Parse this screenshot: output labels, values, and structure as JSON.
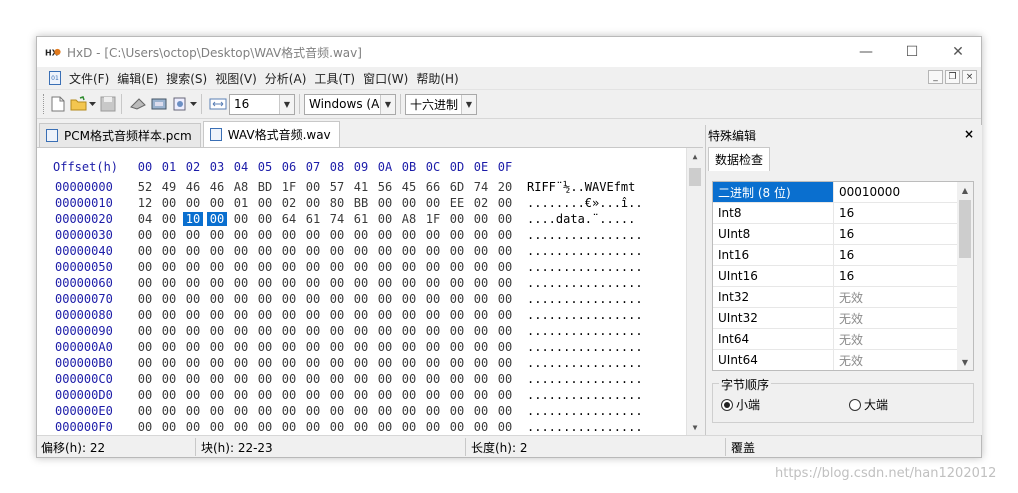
{
  "window": {
    "title": "HxD - [C:\\Users\\octop\\Desktop\\WAV格式音频.wav]",
    "minimize": "—",
    "maximize": "☐",
    "close": "✕"
  },
  "menu": {
    "items": [
      "文件(F)",
      "编辑(E)",
      "搜索(S)",
      "视图(V)",
      "分析(A)",
      "工具(T)",
      "窗口(W)",
      "帮助(H)"
    ],
    "mdi_min": "_",
    "mdi_restore": "❐",
    "mdi_close": "×"
  },
  "toolbar": {
    "bytes_per_row": "16",
    "charset": "Windows (AN",
    "display_mode": "十六进制"
  },
  "tabs": [
    {
      "label": "PCM格式音频样本.pcm",
      "active": false
    },
    {
      "label": "WAV格式音频.wav",
      "active": true
    }
  ],
  "hex": {
    "offset_header": "Offset(h)",
    "columns": [
      "00",
      "01",
      "02",
      "03",
      "04",
      "05",
      "06",
      "07",
      "08",
      "09",
      "0A",
      "0B",
      "0C",
      "0D",
      "0E",
      "0F"
    ],
    "rows": [
      {
        "offset": "00000000",
        "bytes": [
          "52",
          "49",
          "46",
          "46",
          "A8",
          "BD",
          "1F",
          "00",
          "57",
          "41",
          "56",
          "45",
          "66",
          "6D",
          "74",
          "20"
        ],
        "text": "RIFF¨½..WAVEfmt "
      },
      {
        "offset": "00000010",
        "bytes": [
          "12",
          "00",
          "00",
          "00",
          "01",
          "00",
          "02",
          "00",
          "80",
          "BB",
          "00",
          "00",
          "00",
          "EE",
          "02",
          "00"
        ],
        "text": "........€»...î.."
      },
      {
        "offset": "00000020",
        "bytes": [
          "04",
          "00",
          "10",
          "00",
          "00",
          "00",
          "64",
          "61",
          "74",
          "61",
          "00",
          "A8",
          "1F",
          "00",
          "00",
          "00"
        ],
        "text": "....data.¨....."
      },
      {
        "offset": "00000030",
        "bytes": [
          "00",
          "00",
          "00",
          "00",
          "00",
          "00",
          "00",
          "00",
          "00",
          "00",
          "00",
          "00",
          "00",
          "00",
          "00",
          "00"
        ],
        "text": "................"
      },
      {
        "offset": "00000040",
        "bytes": [
          "00",
          "00",
          "00",
          "00",
          "00",
          "00",
          "00",
          "00",
          "00",
          "00",
          "00",
          "00",
          "00",
          "00",
          "00",
          "00"
        ],
        "text": "................"
      },
      {
        "offset": "00000050",
        "bytes": [
          "00",
          "00",
          "00",
          "00",
          "00",
          "00",
          "00",
          "00",
          "00",
          "00",
          "00",
          "00",
          "00",
          "00",
          "00",
          "00"
        ],
        "text": "................"
      },
      {
        "offset": "00000060",
        "bytes": [
          "00",
          "00",
          "00",
          "00",
          "00",
          "00",
          "00",
          "00",
          "00",
          "00",
          "00",
          "00",
          "00",
          "00",
          "00",
          "00"
        ],
        "text": "................"
      },
      {
        "offset": "00000070",
        "bytes": [
          "00",
          "00",
          "00",
          "00",
          "00",
          "00",
          "00",
          "00",
          "00",
          "00",
          "00",
          "00",
          "00",
          "00",
          "00",
          "00"
        ],
        "text": "................"
      },
      {
        "offset": "00000080",
        "bytes": [
          "00",
          "00",
          "00",
          "00",
          "00",
          "00",
          "00",
          "00",
          "00",
          "00",
          "00",
          "00",
          "00",
          "00",
          "00",
          "00"
        ],
        "text": "................"
      },
      {
        "offset": "00000090",
        "bytes": [
          "00",
          "00",
          "00",
          "00",
          "00",
          "00",
          "00",
          "00",
          "00",
          "00",
          "00",
          "00",
          "00",
          "00",
          "00",
          "00"
        ],
        "text": "................"
      },
      {
        "offset": "000000A0",
        "bytes": [
          "00",
          "00",
          "00",
          "00",
          "00",
          "00",
          "00",
          "00",
          "00",
          "00",
          "00",
          "00",
          "00",
          "00",
          "00",
          "00"
        ],
        "text": "................"
      },
      {
        "offset": "000000B0",
        "bytes": [
          "00",
          "00",
          "00",
          "00",
          "00",
          "00",
          "00",
          "00",
          "00",
          "00",
          "00",
          "00",
          "00",
          "00",
          "00",
          "00"
        ],
        "text": "................"
      },
      {
        "offset": "000000C0",
        "bytes": [
          "00",
          "00",
          "00",
          "00",
          "00",
          "00",
          "00",
          "00",
          "00",
          "00",
          "00",
          "00",
          "00",
          "00",
          "00",
          "00"
        ],
        "text": "................"
      },
      {
        "offset": "000000D0",
        "bytes": [
          "00",
          "00",
          "00",
          "00",
          "00",
          "00",
          "00",
          "00",
          "00",
          "00",
          "00",
          "00",
          "00",
          "00",
          "00",
          "00"
        ],
        "text": "................"
      },
      {
        "offset": "000000E0",
        "bytes": [
          "00",
          "00",
          "00",
          "00",
          "00",
          "00",
          "00",
          "00",
          "00",
          "00",
          "00",
          "00",
          "00",
          "00",
          "00",
          "00"
        ],
        "text": "................"
      },
      {
        "offset": "000000F0",
        "bytes": [
          "00",
          "00",
          "00",
          "00",
          "00",
          "00",
          "00",
          "00",
          "00",
          "00",
          "00",
          "00",
          "00",
          "00",
          "00",
          "00"
        ],
        "text": "................"
      }
    ]
  },
  "side_panel": {
    "title": "特殊编辑",
    "close": "×",
    "tab": "数据检查",
    "rows": [
      {
        "label": "二进制 (8 位)",
        "value": "00010000",
        "selected": true,
        "na": false
      },
      {
        "label": "Int8",
        "value": "16",
        "selected": false,
        "na": false
      },
      {
        "label": "UInt8",
        "value": "16",
        "selected": false,
        "na": false
      },
      {
        "label": "Int16",
        "value": "16",
        "selected": false,
        "na": false
      },
      {
        "label": "UInt16",
        "value": "16",
        "selected": false,
        "na": false
      },
      {
        "label": "Int32",
        "value": "无效",
        "selected": false,
        "na": true
      },
      {
        "label": "UInt32",
        "value": "无效",
        "selected": false,
        "na": true
      },
      {
        "label": "Int64",
        "value": "无效",
        "selected": false,
        "na": true
      },
      {
        "label": "UInt64",
        "value": "无效",
        "selected": false,
        "na": true
      }
    ],
    "byte_order": {
      "legend": "字节顺序",
      "little": "小端",
      "big": "大端",
      "selected": "little"
    }
  },
  "status": {
    "offset": "偏移(h): 22",
    "block": "块(h): 22-23",
    "length": "长度(h): 2",
    "mode": "覆盖"
  },
  "watermark": "https://blog.csdn.net/han1202012",
  "colors": {
    "selection": "#0a6fcf",
    "offset_blue": "#1c1ca8"
  }
}
